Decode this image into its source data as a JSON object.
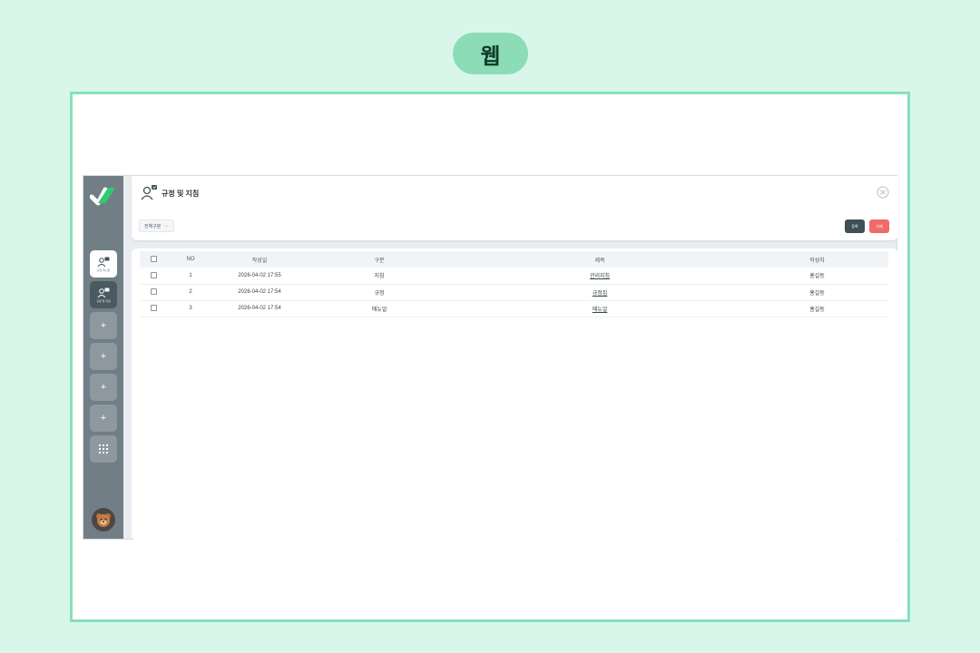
{
  "pill_label": "웹",
  "page": {
    "title": "규정 및 지침",
    "filter_label": "전체구분",
    "register_label": "등록",
    "delete_label": "삭제"
  },
  "sidebar": {
    "items": [
      {
        "label": "규정 게시판",
        "icon": "user-board-icon"
      },
      {
        "label": "규정 및 지침",
        "icon": "user-board-icon"
      },
      {
        "label": "+"
      },
      {
        "label": "+"
      },
      {
        "label": "+"
      },
      {
        "label": "+"
      }
    ],
    "grid_icon": "grid-icon",
    "avatar_icon": "bear-avatar-icon"
  },
  "table": {
    "columns": [
      "NO",
      "작성일",
      "구분",
      "제목",
      "작성자"
    ],
    "rows": [
      {
        "no": "1",
        "date": "2026-04-02 17:55",
        "type": "지침",
        "title": "관리지침",
        "author": "홍길동"
      },
      {
        "no": "2",
        "date": "2026-04-02 17:54",
        "type": "규정",
        "title": "규정집",
        "author": "홍길동"
      },
      {
        "no": "3",
        "date": "2026-04-02 17:54",
        "type": "매뉴얼",
        "title": "매뉴얼",
        "author": "홍길동"
      }
    ]
  },
  "colors": {
    "background": "#d8f7ea",
    "frame_border": "#86e0bd",
    "sidebar": "#717e86",
    "register_button": "#3f5057",
    "delete_button": "#f06a6a"
  }
}
